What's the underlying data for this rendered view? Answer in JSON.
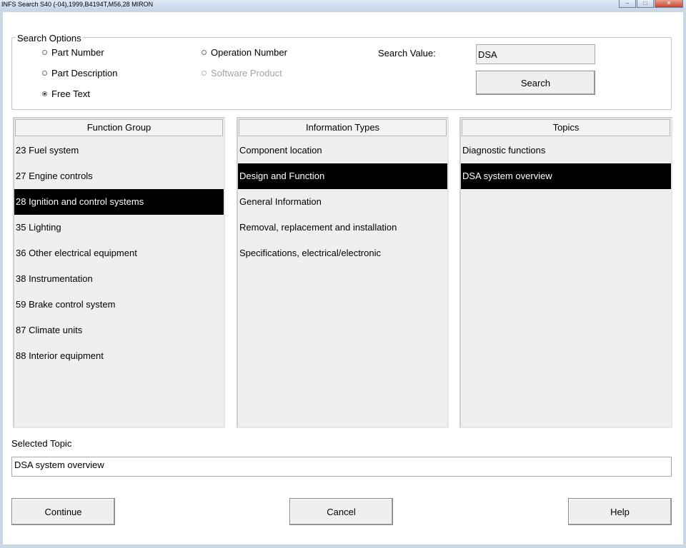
{
  "window": {
    "title": "INFS Search S40 (-04),1999,B4194T,M56,28 MIRON",
    "controls": {
      "minimize": "–",
      "maximize": "□",
      "close": "✕"
    }
  },
  "search_options": {
    "title": "Search Options",
    "radios": {
      "part_number": "Part Number",
      "part_description": "Part Description",
      "free_text": "Free Text",
      "operation_number": "Operation Number",
      "software_product": "Software Product"
    },
    "selected": "free_text",
    "search_value_label": "Search Value:",
    "search_value": "DSA",
    "search_button": "Search"
  },
  "function_group": {
    "header": "Function Group",
    "items": [
      "23 Fuel system",
      "27 Engine controls",
      "28 Ignition and control systems",
      "35 Lighting",
      "36 Other electrical equipment",
      "38 Instrumentation",
      "59 Brake control system",
      "87 Climate units",
      "88 Interior equipment"
    ],
    "selected_index": 2
  },
  "information_types": {
    "header": "Information Types",
    "items": [
      "Component location",
      "Design and Function",
      "General Information",
      "Removal, replacement and installation",
      "Specifications, electrical/electronic"
    ],
    "selected_index": 1
  },
  "topics": {
    "header": "Topics",
    "items": [
      "Diagnostic functions",
      "DSA system overview"
    ],
    "selected_index": 1
  },
  "selected_topic": {
    "label": "Selected Topic",
    "value": "DSA system overview"
  },
  "footer": {
    "continue": "Continue",
    "cancel": "Cancel",
    "help": "Help"
  }
}
